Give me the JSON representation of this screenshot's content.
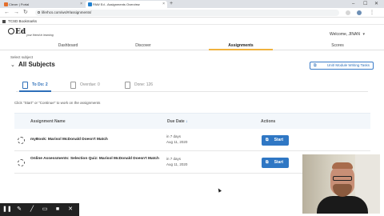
{
  "browser": {
    "tabs": [
      {
        "title": "Clever | Portal"
      },
      {
        "title": "PAW Ed - Assignments Overview"
      }
    ],
    "new_tab": "+",
    "url": "liferhcs.com/ws/#/assignments/",
    "bookmark": "TCSD Bookmarks",
    "controls": {
      "minimize": "–",
      "maximize": "☐",
      "close": "✕"
    }
  },
  "app": {
    "logo": "Ed",
    "tagline": "your friend in learning",
    "welcome": "Welcome, JINAN",
    "nav": [
      {
        "label": "Dashboard",
        "active": false
      },
      {
        "label": "Discover",
        "active": false
      },
      {
        "label": "Assignments",
        "active": true
      },
      {
        "label": "Scores",
        "active": false
      }
    ]
  },
  "subject": {
    "label": "Select subject",
    "value": "All Subjects"
  },
  "unit_button": "Unit/ Module Writing Tasks",
  "subtabs": [
    {
      "label": "To Do: 2",
      "active": true
    },
    {
      "label": "Overdue: 0",
      "active": false
    },
    {
      "label": "Done: 126",
      "active": false
    }
  ],
  "hint": "Click \"Start\" or \"Continue\" to work on the assignments",
  "table": {
    "headers": {
      "name": "Assignment Name",
      "due": "Due Date",
      "due_arrow": "↓",
      "actions": "Actions"
    },
    "rows": [
      {
        "name": "myBook: Marisol McDonald Doesn't Match",
        "due_relative": "in 7 days",
        "due_date": "Aug 11, 2020",
        "action": "Start"
      },
      {
        "name": "Online Assessments: Selection Quiz: Marisol McDonald Doesn't Match",
        "due_relative": "in 7 days",
        "due_date": "Aug 11, 2020",
        "action": "Start"
      }
    ]
  },
  "colors": {
    "accent": "#2f77c4",
    "nav_underline": "#f0b23e"
  },
  "toolbar_icons": [
    "pause-icon",
    "pen-icon",
    "marker-icon",
    "eraser-icon",
    "camera-icon",
    "close-icon"
  ]
}
